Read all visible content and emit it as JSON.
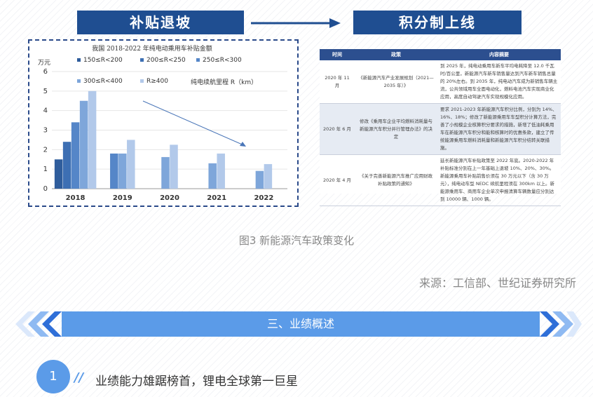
{
  "header": {
    "left_banner": "补贴退坡",
    "right_banner": "积分制上线"
  },
  "chart_data": {
    "type": "bar",
    "title": "我国 2018-2022 年纯电动乘用车补贴金额",
    "ylabel": "万元",
    "range_label": "纯电续航里程 R（km）",
    "categories": [
      "2018",
      "2019",
      "2020",
      "2021",
      "2022"
    ],
    "ylim": [
      0,
      6
    ],
    "yticks": [
      "0",
      "1",
      "2",
      "3",
      "4",
      "5",
      "6"
    ],
    "series": [
      {
        "name": "150≤R<200",
        "color": "#2f5d9c",
        "values": [
          1.5,
          null,
          null,
          null,
          null
        ]
      },
      {
        "name": "200≤R<250",
        "color": "#3d6fb3",
        "values": [
          2.4,
          null,
          null,
          null,
          null
        ]
      },
      {
        "name": "250≤R<300",
        "color": "#5586c8",
        "values": [
          3.4,
          1.8,
          null,
          null,
          null
        ]
      },
      {
        "name": "300≤R<400",
        "color": "#7ea6da",
        "values": [
          4.5,
          1.8,
          1.62,
          1.3,
          0.91
        ]
      },
      {
        "name": "R≥400",
        "color": "#b2c9ea",
        "values": [
          5.0,
          2.5,
          2.25,
          1.8,
          1.26
        ]
      }
    ]
  },
  "table": {
    "headers": [
      "时间",
      "政策",
      "内容摘要"
    ],
    "rows": [
      {
        "time": "2020 年 11 月",
        "policy": "《新能源汽车产业发展规划（2021—2035 年）》",
        "summary": "到 2025 年，纯电动乘用车新车平均电耗降至 12.0 千瓦时/百公里，新能源汽车新车销售量达到汽车新车销售总量的 20%左右。到 2035 年，纯电动汽车成为新销售车辆主流，公共领域用车全面电动化，燃料电池汽车实现商业化应用，高度自动驾驶汽车实现规模化应用。"
      },
      {
        "time": "2020 年 6 月",
        "policy": "修改《乘用车企业平均燃料消耗量与新能源汽车积分并行管理办法》的决定",
        "summary": "要求 2021-2023 年新能源汽车积分比例，分别为 14%、16%、18%；修改了新能源乘用车车型积分计算方法，完善了小规模企业核算积分要求的措施，新增了低油耗乘用车在新能源汽车积分和能和核算时的优惠条款，建立了传统能源乘用车燃料消耗量和新能源汽车积分结转关联措施。"
      },
      {
        "time": "2020 年 4 月",
        "policy": "《关于完善新能源汽车推广应用财政补贴政策的通知》",
        "summary": "延长新能源汽车补贴政策至 2022 年底。2020-2022 年补贴标准分别在上一年基础上退坡 10%、20%、30%。新能源乘用车补贴前售价须在 30 万元以下（含 30 万元），纯电动车型 NEDC 续航里程须在 300km 以上。新能源乘用车、商用车企业单次申报清算车辆数量应分别达到 10000 辆、1000 辆。"
      }
    ]
  },
  "caption": "图3 新能源汽车政策变化",
  "source": "来源：工信部、世纪证券研究所",
  "section": {
    "title": "三、业绩概述"
  },
  "subsection": {
    "number": "1",
    "slashes": "//",
    "text": "业绩能力雄踞榜首，锂电全球第一巨星"
  }
}
